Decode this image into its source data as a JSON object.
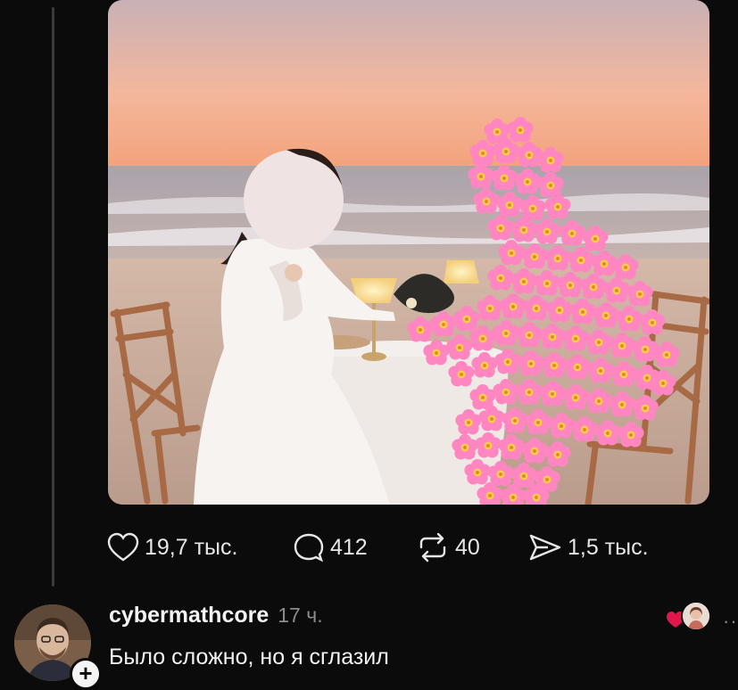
{
  "post": {
    "image_alt": "beach dinner photo",
    "stats": {
      "likes": "19,7 тыс.",
      "comments": "412",
      "reposts": "40",
      "shares": "1,5 тыс."
    }
  },
  "reply": {
    "username": "cybermathcore",
    "timestamp": "17 ч.",
    "text": "Было сложно, но я сглазил",
    "follow_symbol": "+",
    "more_symbol": "··"
  },
  "colors": {
    "background": "#0b0b0c",
    "text": "#f2f2f2",
    "muted": "#8c8c8c",
    "heart": "#e0174a",
    "flower": "#ff86c0"
  }
}
